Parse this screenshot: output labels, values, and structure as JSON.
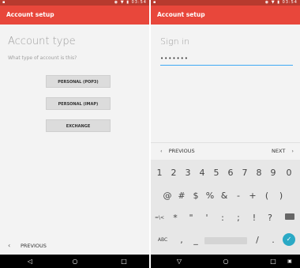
{
  "status_bar": {
    "time": "03:54"
  },
  "left": {
    "appbar_title": "Account setup",
    "heading": "Account type",
    "question": "What type of account is this?",
    "options": [
      "PERSONAL (POP3)",
      "PERSONAL (IMAP)",
      "EXCHANGE"
    ],
    "footer_previous": "PREVIOUS"
  },
  "right": {
    "appbar_title": "Account setup",
    "heading": "Sign in",
    "password_mask": "•••••••",
    "kb_previous": "PREVIOUS",
    "kb_next": "NEXT",
    "keyboard": {
      "row1": [
        "1",
        "2",
        "3",
        "4",
        "5",
        "6",
        "7",
        "8",
        "9",
        "0"
      ],
      "row2": [
        "@",
        "#",
        "$",
        "%",
        "&",
        "-",
        "+",
        "(",
        ")"
      ],
      "row3": [
        "=\\<",
        "*",
        "\"",
        "'",
        ":",
        ";",
        "!",
        "?"
      ],
      "row4": [
        "ABC",
        ",",
        "_",
        "/",
        "."
      ]
    }
  },
  "colors": {
    "appbar": "#e8473b",
    "statusbar": "#b73a2e",
    "accent": "#3fa9f5",
    "enter": "#2aa9c5"
  }
}
